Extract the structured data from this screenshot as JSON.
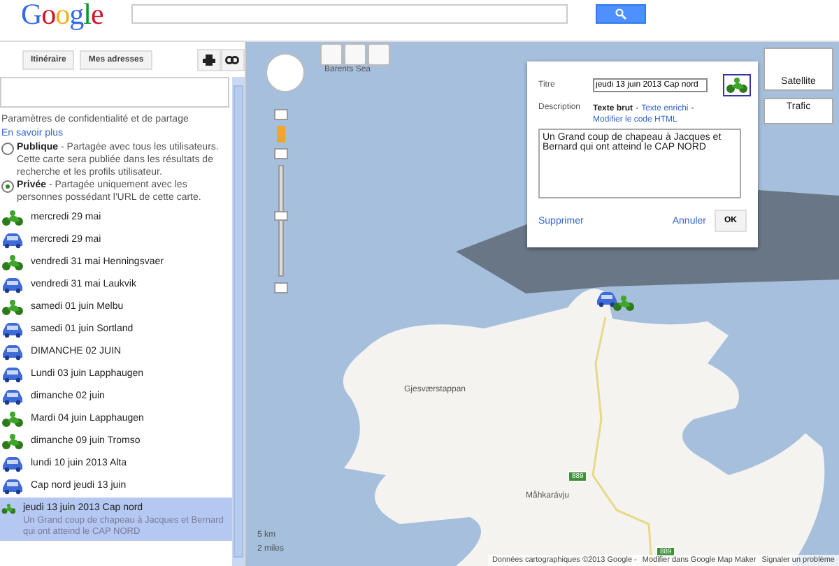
{
  "header": {
    "logo": "Google"
  },
  "toolbar": {
    "buttons": [
      "Itinéraire",
      "Mes adresses"
    ]
  },
  "privacy": {
    "title": "Paramètres de confidentialité et de partage",
    "link": "En savoir plus",
    "options": [
      {
        "label": "Publique",
        "text": " - Partagée avec tous les utilisateurs. Cette carte sera publiée dans les résultats de recherche et les profils utilisateur.",
        "selected": false
      },
      {
        "label": "Privée",
        "text": " - Partagée uniquement avec les personnes possédant l'URL de cette carte.",
        "selected": true
      }
    ]
  },
  "places": [
    {
      "kind": "moto",
      "title": "mercredi 29 mai",
      "selected": false
    },
    {
      "kind": "car",
      "title": "mercredi 29 mai",
      "selected": false
    },
    {
      "kind": "moto",
      "title": "vendredi 31 mai  Henningsvaer",
      "selected": false
    },
    {
      "kind": "car",
      "title": "vendredi 31 mai Laukvik",
      "selected": false
    },
    {
      "kind": "moto",
      "title": "samedi 01 juin Melbu",
      "selected": false
    },
    {
      "kind": "car",
      "title": "samedi 01 juin Sortland",
      "selected": false
    },
    {
      "kind": "car",
      "title": "DIMANCHE 02 JUIN",
      "selected": false
    },
    {
      "kind": "car",
      "title": "Lundi 03 juin Lapphaugen",
      "selected": false
    },
    {
      "kind": "car",
      "title": "dimanche 02 juin",
      "selected": false
    },
    {
      "kind": "moto",
      "title": "Mardi 04 juin Lapphaugen",
      "selected": false
    },
    {
      "kind": "moto",
      "title": "dimanche 09 juin Tromso",
      "selected": false
    },
    {
      "kind": "car",
      "title": "lundi 10 juin 2013 Alta",
      "selected": false
    },
    {
      "kind": "car",
      "title": "Cap nord jeudi 13 juin",
      "selected": false
    },
    {
      "kind": "moto",
      "title": "jeudi 13 juin 2013 Cap nord",
      "description": "Un Grand coup de chapeau à Jacques et Bernard qui ont atteind le CAP NORD",
      "selected": true
    }
  ],
  "map": {
    "zoom": {
      "level": 0.55
    },
    "sea_label": "Barents Sea",
    "labels": [
      "Gjesværstappan",
      "Måhkarávju"
    ],
    "road_shields": [
      "889",
      "889"
    ],
    "map_types": [
      "Satellite",
      "Trafic"
    ],
    "scale": [
      "5 km",
      "2 miles"
    ],
    "footer": [
      "Données cartographiques ©2013 Google -",
      "Modifier dans Google Map Maker",
      "Signaler un problème"
    ]
  },
  "popup": {
    "title_label": "Titre",
    "title_value": "jeudi 13 juin 2013 Cap nord",
    "description_label": "Description",
    "mode_separator": "-",
    "modes": [
      {
        "label": "Texte brut",
        "selected": true
      },
      {
        "label": "Texte enrichi",
        "selected": false
      },
      {
        "label": "Modifier le code HTML",
        "selected": false
      }
    ],
    "description_value": "Un Grand coup de chapeau à Jacques et Bernard qui ont atteind le CAP NORD",
    "delete": "Supprimer",
    "cancel": "Annuler",
    "ok": "OK"
  }
}
